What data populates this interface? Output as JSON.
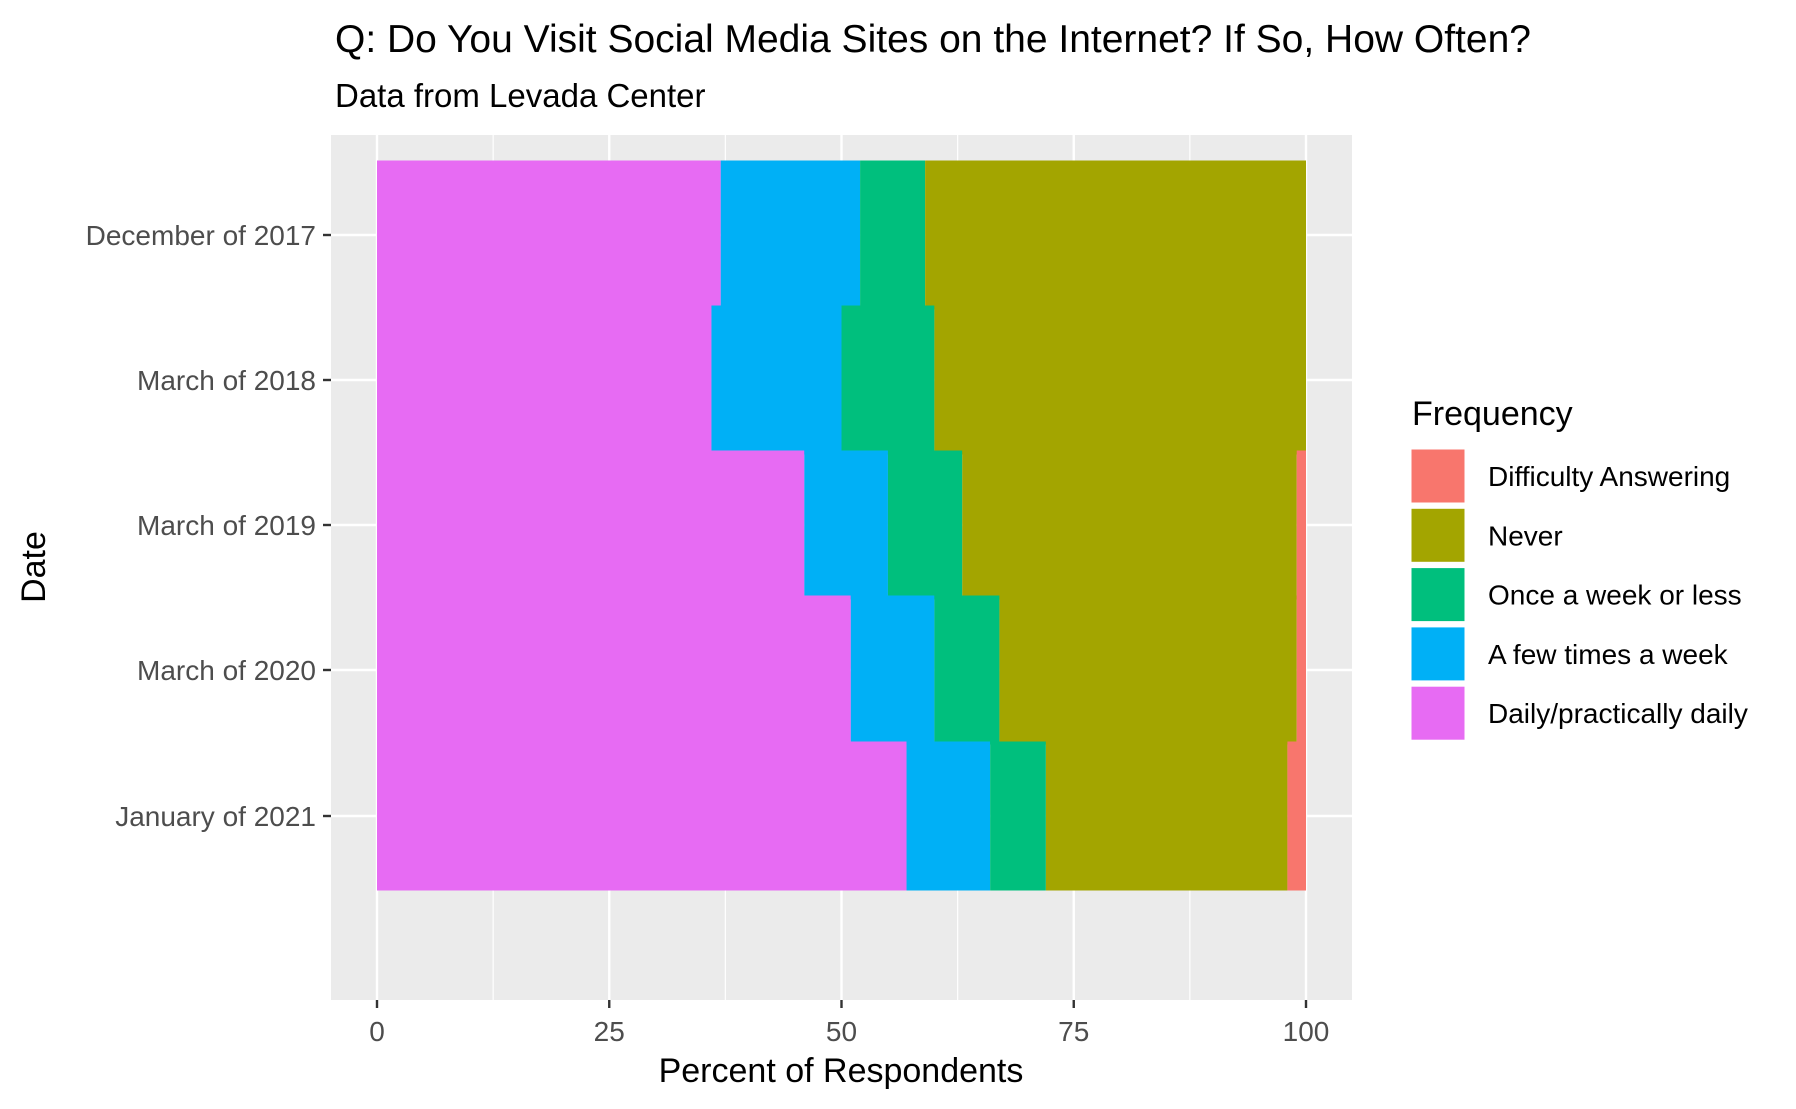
{
  "chart_data": {
    "type": "bar",
    "orientation": "horizontal",
    "stacked": true,
    "title": "Q: Do You Visit Social Media Sites on the Internet? If So, How Often?",
    "subtitle": "Data from Levada Center",
    "xlabel": "Percent of Respondents",
    "ylabel": "Date",
    "xlim": [
      0,
      100
    ],
    "xticks": [
      0,
      25,
      50,
      75,
      100
    ],
    "xtick_labels": [
      "0",
      "25",
      "50",
      "75",
      "100"
    ],
    "grid": true,
    "categories": [
      "December of 2017",
      "March of 2018",
      "March of 2019",
      "March of 2020",
      "January of 2021"
    ],
    "legend": {
      "title": "Frequency",
      "placement": "right",
      "entries": [
        "Difficulty Answering",
        "Never",
        "Once a week or less",
        "A few times a week",
        "Daily/practically daily"
      ]
    },
    "series": [
      {
        "name": "Daily/practically daily",
        "color": "#E76BF3",
        "values": [
          37,
          36,
          46,
          51,
          57
        ]
      },
      {
        "name": "A few times a week",
        "color": "#00B0F6",
        "values": [
          15,
          14,
          9,
          9,
          9
        ]
      },
      {
        "name": "Once a week or less",
        "color": "#00BF7D",
        "values": [
          7,
          10,
          8,
          7,
          6
        ]
      },
      {
        "name": "Never",
        "color": "#A3A500",
        "values": [
          41,
          40,
          36,
          32,
          26
        ]
      },
      {
        "name": "Difficulty Answering",
        "color": "#F8766D",
        "values": [
          0,
          0,
          1,
          1,
          2
        ]
      }
    ]
  },
  "colors": {
    "panel_background": "#EBEBEB",
    "grid": "#FFFFFF"
  }
}
